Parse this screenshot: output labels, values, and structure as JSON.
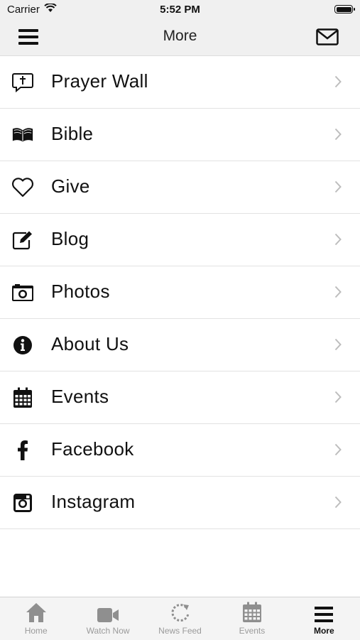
{
  "status_bar": {
    "carrier": "Carrier",
    "time": "5:52 PM"
  },
  "nav": {
    "title": "More"
  },
  "menu_items": [
    {
      "label": "Prayer Wall",
      "icon": "prayer-bubble-icon"
    },
    {
      "label": "Bible",
      "icon": "book-icon"
    },
    {
      "label": "Give",
      "icon": "heart-icon"
    },
    {
      "label": "Blog",
      "icon": "edit-icon"
    },
    {
      "label": "Photos",
      "icon": "camera-icon"
    },
    {
      "label": "About Us",
      "icon": "info-icon"
    },
    {
      "label": "Events",
      "icon": "calendar-icon"
    },
    {
      "label": "Facebook",
      "icon": "facebook-icon"
    },
    {
      "label": "Instagram",
      "icon": "instagram-icon"
    }
  ],
  "tabs": [
    {
      "label": "Home",
      "icon": "home-icon"
    },
    {
      "label": "Watch Now",
      "icon": "video-icon"
    },
    {
      "label": "News Feed",
      "icon": "refresh-icon"
    },
    {
      "label": "Events",
      "icon": "calendar-icon"
    },
    {
      "label": "More",
      "icon": "menu-icon",
      "active": true
    }
  ],
  "colors": {
    "bar_bg": "#f0f0f0",
    "tab_inactive": "#9a9a9a",
    "text": "#111111"
  }
}
